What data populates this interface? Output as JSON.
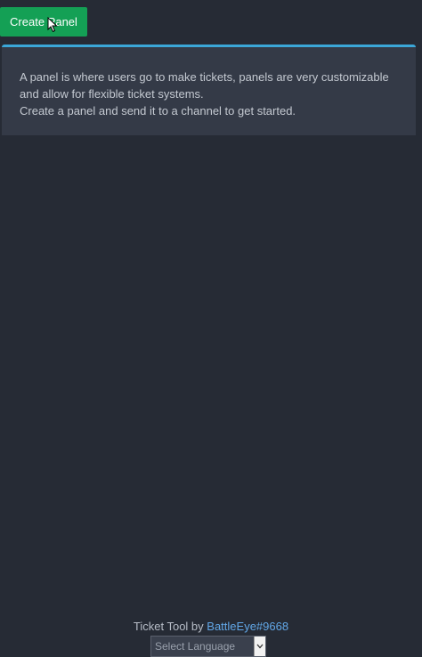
{
  "toolbar": {
    "create_panel_label": "Create Panel"
  },
  "info": {
    "line1": "A panel is where users go to make tickets, panels are very customizable and allow for flexible ticket systems.",
    "line2": "Create a panel and send it to a channel to get started."
  },
  "footer": {
    "prefix": "Ticket Tool by ",
    "author": "BattleEye#9668"
  },
  "language_select": {
    "selected": "Select Language"
  },
  "colors": {
    "background": "#262b35",
    "create_button": "#14a055",
    "panel_accent": "#3ba7d8",
    "link": "#62a8e8"
  }
}
